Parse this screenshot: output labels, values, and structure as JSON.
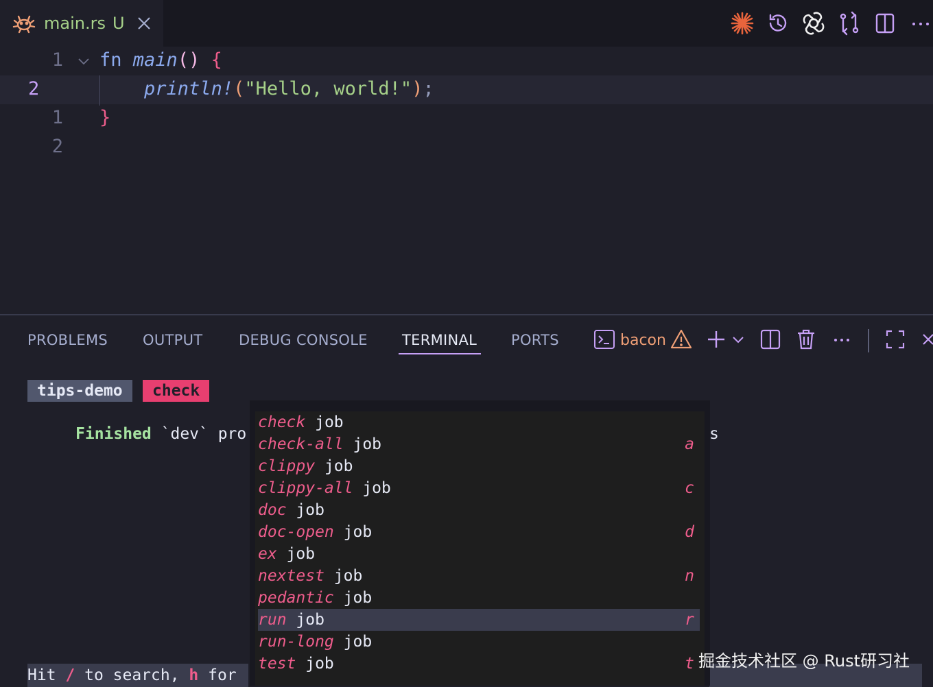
{
  "tab": {
    "title": "main.rs",
    "badge": "U"
  },
  "editor": {
    "line_numbers": [
      "1",
      "2",
      "1",
      "2"
    ],
    "line1": {
      "kw": "fn",
      "fn": "main",
      "parens": "()",
      "brace": "{"
    },
    "line2": {
      "indent": "    ",
      "macro": "println!",
      "open": "(",
      "string": "\"Hello, world!\"",
      "close": ")",
      "semi": ";"
    },
    "line3": {
      "brace": "}"
    }
  },
  "panel": {
    "tabs": [
      "PROBLEMS",
      "OUTPUT",
      "DEBUG CONSOLE",
      "TERMINAL",
      "PORTS"
    ],
    "active_tab": "TERMINAL",
    "terminal_name": "bacon"
  },
  "terminal": {
    "project_badge": "tips-demo",
    "job_badge": "check",
    "finished_word": "Finished",
    "finished_rest": " `dev` pro",
    "trailing": "s",
    "hint": {
      "p1": "Hit ",
      "k1": "/",
      "p2": " to search, ",
      "k2": "h",
      "p3": " for"
    }
  },
  "job_menu": {
    "suffix": "job",
    "items": [
      {
        "name": "check",
        "key": ""
      },
      {
        "name": "check-all",
        "key": "a"
      },
      {
        "name": "clippy",
        "key": ""
      },
      {
        "name": "clippy-all",
        "key": "c"
      },
      {
        "name": "doc",
        "key": ""
      },
      {
        "name": "doc-open",
        "key": "d"
      },
      {
        "name": "ex",
        "key": ""
      },
      {
        "name": "nextest",
        "key": "n"
      },
      {
        "name": "pedantic",
        "key": ""
      },
      {
        "name": "run",
        "key": "r",
        "selected": true
      },
      {
        "name": "run-long",
        "key": ""
      },
      {
        "name": "test",
        "key": "t"
      }
    ]
  },
  "watermark": "掘金技术社区 @ Rust研习社",
  "colors": {
    "accent": "#c6a0f6",
    "pink": "#ef5d8c",
    "green": "#a6d189",
    "orange": "#ef9f76"
  },
  "icons": [
    "crab-icon",
    "close-icon",
    "sparkle-icon",
    "history-icon",
    "openai-icon",
    "compare-icon",
    "split-editor-icon",
    "more-icon",
    "terminal-icon",
    "warning-icon",
    "plus-icon",
    "chevron-down-icon",
    "trash-icon",
    "maximize-icon"
  ]
}
